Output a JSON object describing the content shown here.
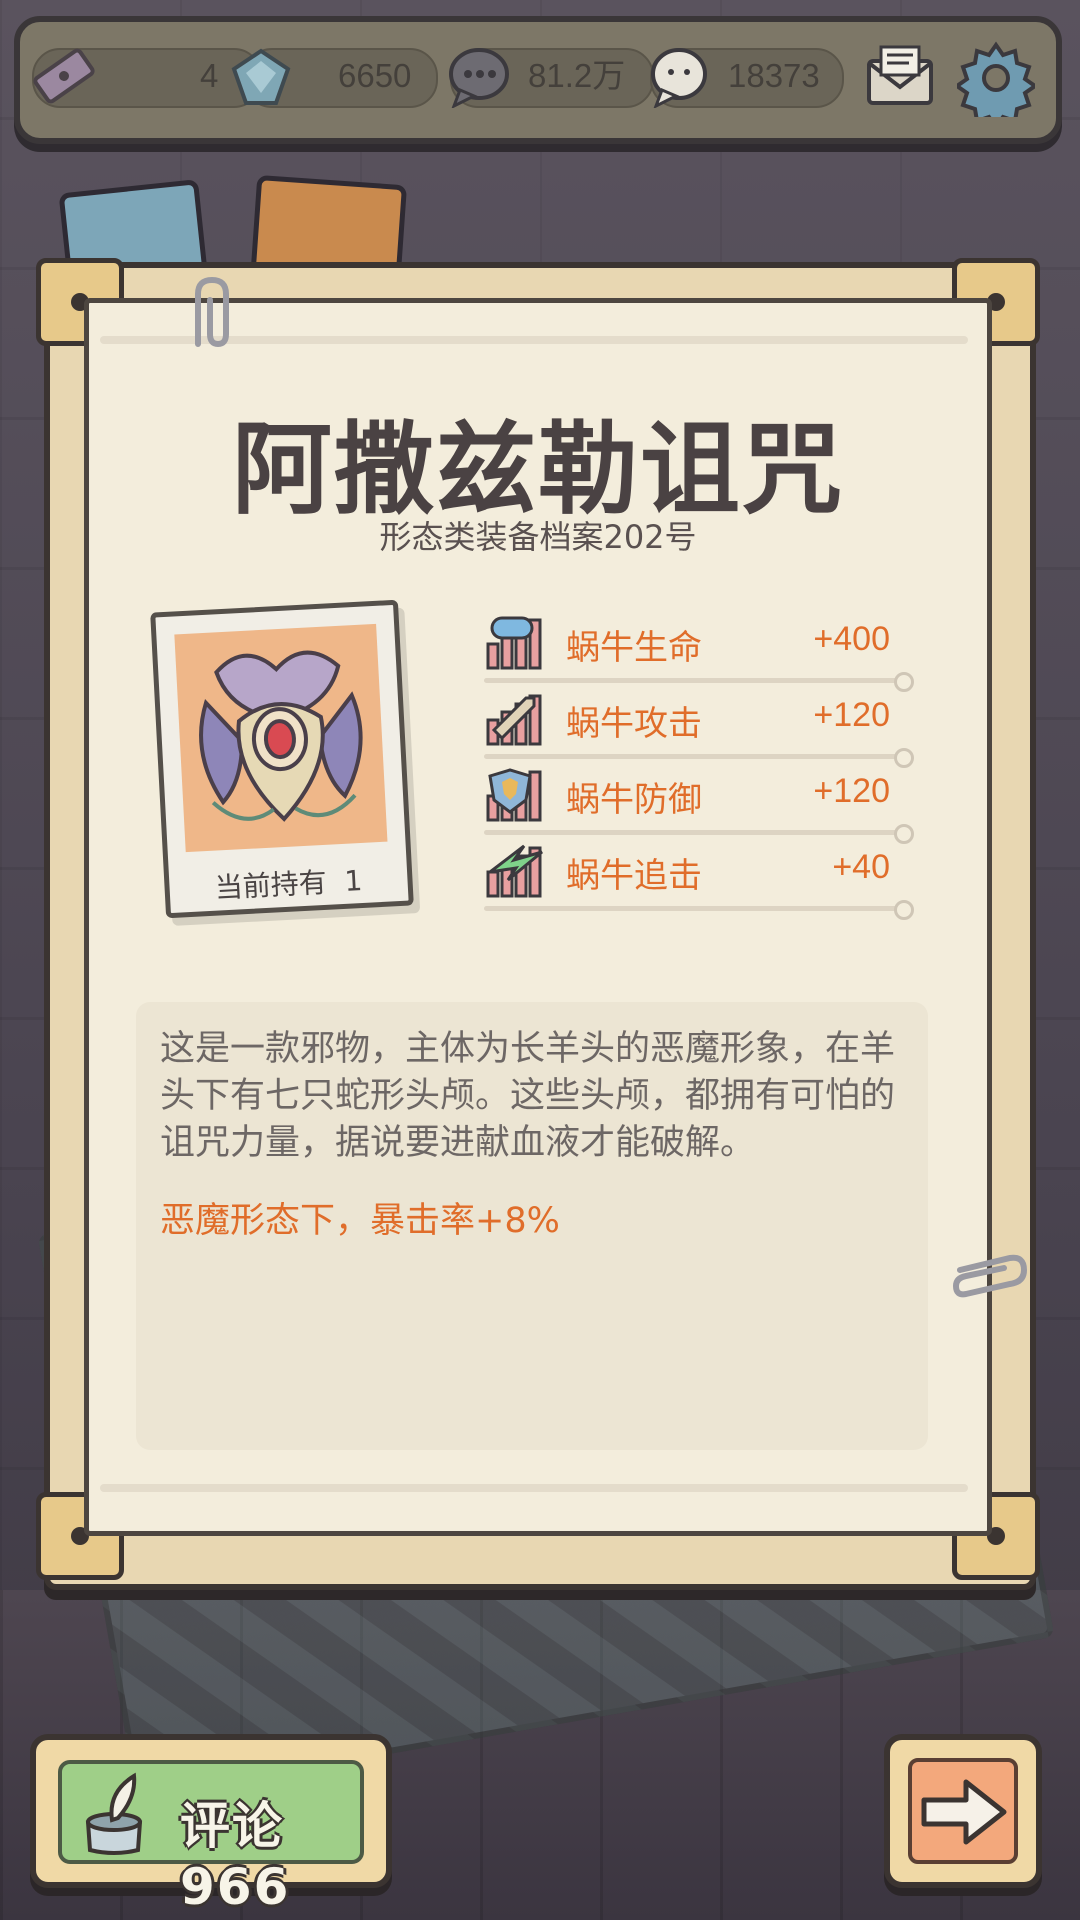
{
  "topbar": {
    "ticket_count": "4",
    "gem_count": "6650",
    "bubble_count": "81.2万",
    "chat_count": "18373",
    "icons": [
      "ticket-icon",
      "gem-icon",
      "speech-bubble-icon",
      "chat-bubble-icon",
      "mail-icon",
      "gear-icon"
    ]
  },
  "equipment": {
    "name": "阿撒兹勒诅咒",
    "archive_label": "形态类装备档案202号",
    "held_label": "当前持有",
    "held_count": "1",
    "stats": [
      {
        "name": "蜗牛生命",
        "value": "+400",
        "icon": "health-icon",
        "color": "#7fb8e0"
      },
      {
        "name": "蜗牛攻击",
        "value": "+120",
        "icon": "sword-icon",
        "color": "#d9b27a"
      },
      {
        "name": "蜗牛防御",
        "value": "+120",
        "icon": "shield-icon",
        "color": "#e9b85a"
      },
      {
        "name": "蜗牛追击",
        "value": "+40",
        "icon": "lightning-icon",
        "color": "#7fd38a"
      }
    ],
    "description": "这是一款邪物，主体为长羊头的恶魔形象，在羊头下有七只蛇形头颅。这些头颅，都拥有可怕的诅咒力量，据说要进献血液才能破解。",
    "effect": "恶魔形态下，暴击率+8%"
  },
  "bottom": {
    "comment_label": "评论",
    "comment_count": "966"
  }
}
